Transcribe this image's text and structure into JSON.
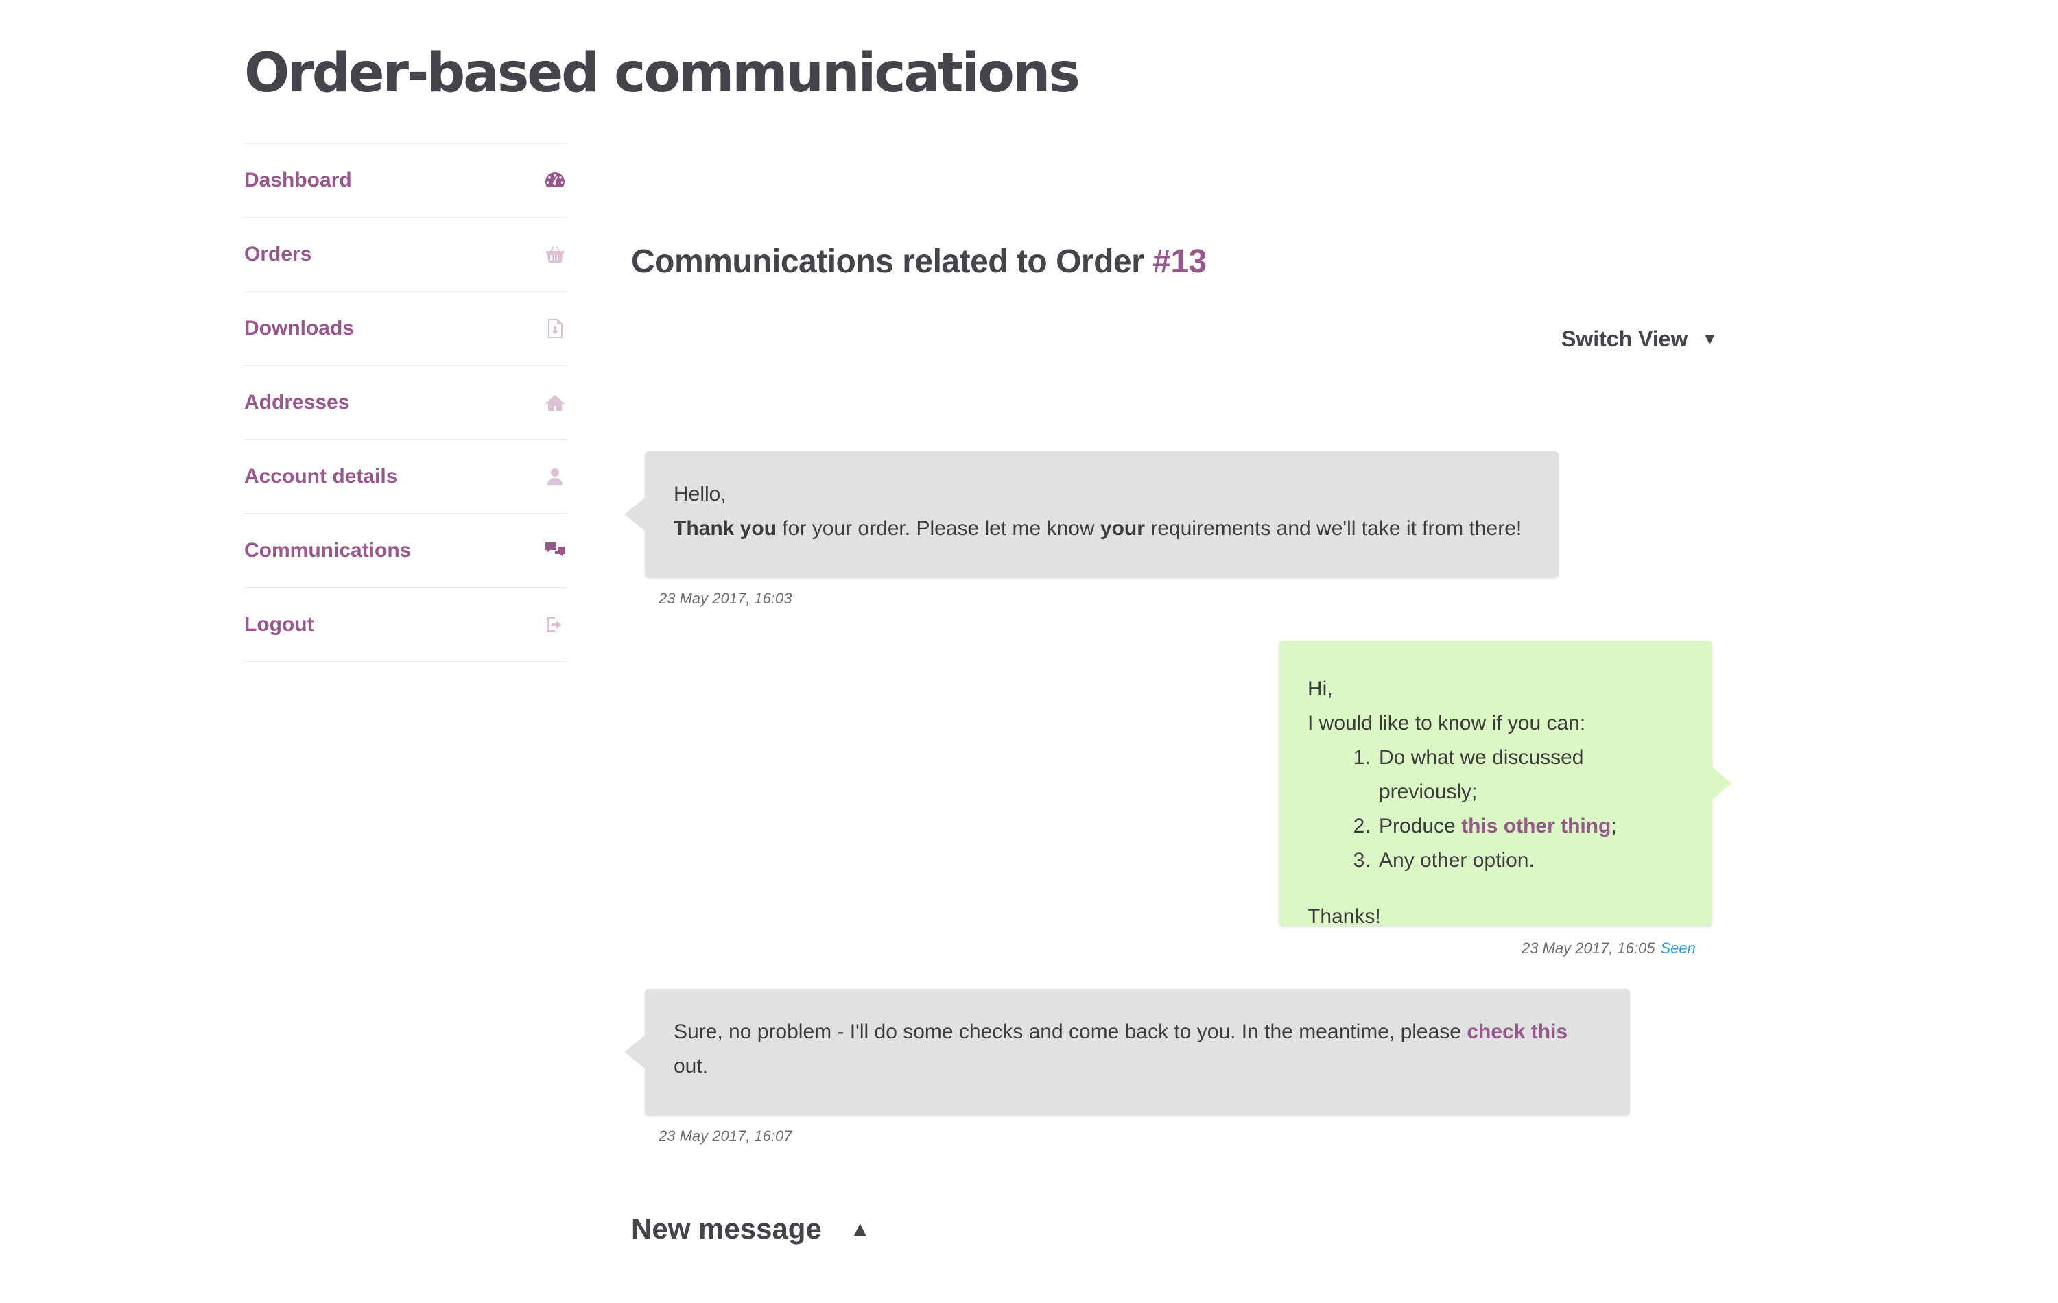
{
  "page": {
    "title": "Order-based communications"
  },
  "sidebar": {
    "items": [
      {
        "label": "Dashboard",
        "icon": "dashboard-icon",
        "active": true
      },
      {
        "label": "Orders",
        "icon": "basket-icon",
        "active": false
      },
      {
        "label": "Downloads",
        "icon": "file-download-icon",
        "active": false
      },
      {
        "label": "Addresses",
        "icon": "home-icon",
        "active": false
      },
      {
        "label": "Account details",
        "icon": "user-icon",
        "active": false
      },
      {
        "label": "Communications",
        "icon": "chat-bubbles-icon",
        "active": true
      },
      {
        "label": "Logout",
        "icon": "sign-out-icon",
        "active": false
      }
    ]
  },
  "main": {
    "title_prefix": "Communications related to Order ",
    "order_number": "#13",
    "switch_view": {
      "label": "Switch View",
      "caret": "▼"
    },
    "messages": [
      {
        "direction": "received",
        "greeting": "Hello,",
        "line_parts": [
          "Thank you",
          " for your order. Please let me know ",
          "your",
          " requirements and we'll take it from there!"
        ],
        "timestamp": "23 May 2017, 16:03"
      },
      {
        "direction": "sent",
        "greeting": "Hi,",
        "intro": "I would like to know if you can:",
        "list": [
          "Do what we discussed previously;",
          {
            "before": "Produce ",
            "link": "this other thing",
            "after": ";"
          },
          "Any other option."
        ],
        "closing": "Thanks!",
        "timestamp": "23 May 2017, 16:05",
        "status": "Seen"
      },
      {
        "direction": "received",
        "text_before": "Sure, no problem - I'll do some checks and come back to you. In the meantime, please ",
        "link": "check this",
        "text_after": "out.",
        "timestamp": "23 May 2017, 16:07"
      }
    ],
    "new_message": {
      "label": "New message",
      "caret": "▲"
    }
  },
  "colors": {
    "accent": "#96588a",
    "received_bubble": "#e1e1e1",
    "sent_bubble": "#dcf7c6",
    "seen": "#3a9ad9",
    "heading": "#43454b"
  }
}
